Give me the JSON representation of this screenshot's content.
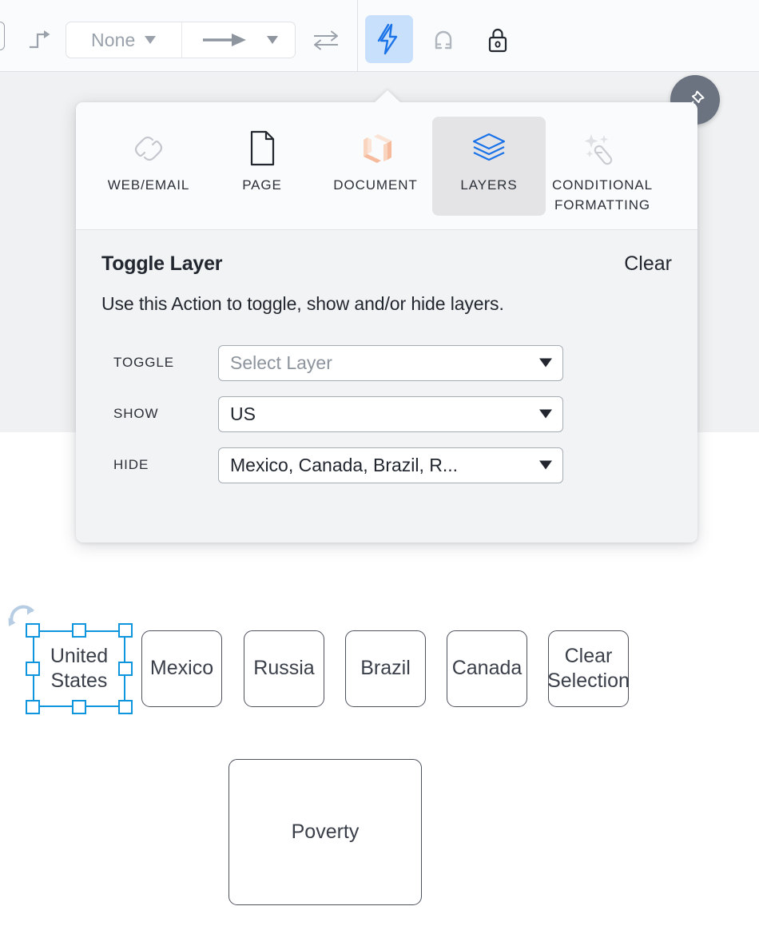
{
  "toolbar": {
    "line_style_label": "None",
    "icons": [
      {
        "name": "connector-route-icon",
        "label": "Route style"
      },
      {
        "name": "swap-arrows-icon",
        "label": "Flip direction"
      },
      {
        "name": "lightning-bolt-icon",
        "label": "Actions",
        "active": true
      },
      {
        "name": "magnet-icon",
        "label": "Snap to grid"
      },
      {
        "name": "lock-icon",
        "label": "Lock"
      }
    ]
  },
  "popup": {
    "pin_icon": "pushpin-icon",
    "tabs": [
      {
        "label": "Web/Email",
        "icon": "link-chain-icon",
        "selected": false
      },
      {
        "label": "Page",
        "icon": "page-document-icon",
        "selected": false
      },
      {
        "label": "Document",
        "icon": "lucid-document-logo-icon",
        "selected": false
      },
      {
        "label": "Layers",
        "icon": "layers-stack-icon",
        "selected": true
      },
      {
        "label": "Conditional Formatting",
        "icon": "magic-wand-sparkle-icon",
        "selected": false
      }
    ],
    "title": "Toggle Layer",
    "clear_label": "Clear",
    "description": "Use this Action to toggle, show and/or hide layers.",
    "fields": [
      {
        "label": "Toggle",
        "value": "Select Layer",
        "is_placeholder": true
      },
      {
        "label": "Show",
        "value": "US",
        "is_placeholder": false
      },
      {
        "label": "Hide",
        "value": "Mexico, Canada, Brazil, R...",
        "is_placeholder": false
      }
    ]
  },
  "canvas": {
    "selected_shape": {
      "lines": [
        "United",
        "States"
      ],
      "selected": true
    },
    "shapes": [
      {
        "lines": [
          "Mexico"
        ]
      },
      {
        "lines": [
          "Russia"
        ]
      },
      {
        "lines": [
          "Brazil"
        ]
      },
      {
        "lines": [
          "Canada"
        ]
      },
      {
        "lines": [
          "Clear",
          "Selection"
        ]
      }
    ],
    "poverty_shape": {
      "lines": [
        "Poverty"
      ]
    }
  },
  "colors": {
    "accent_blue": "#1a73e8",
    "selection_blue": "#0e95dd",
    "tab_selected_bg": "#e4e4e6",
    "panel_bg": "#f2f3f4",
    "workspace_bg": "#f0f1f2",
    "shape_stroke": "#4c515c",
    "document_logo": "#f7c8ae"
  }
}
